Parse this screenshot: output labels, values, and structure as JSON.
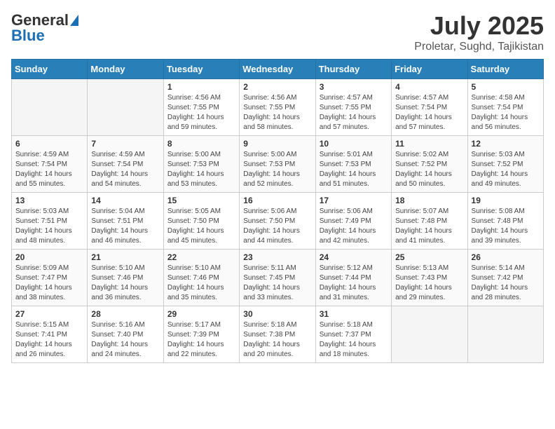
{
  "header": {
    "logo_general": "General",
    "logo_blue": "Blue",
    "month_title": "July 2025",
    "location": "Proletar, Sughd, Tajikistan"
  },
  "weekdays": [
    "Sunday",
    "Monday",
    "Tuesday",
    "Wednesday",
    "Thursday",
    "Friday",
    "Saturday"
  ],
  "weeks": [
    [
      {
        "day": "",
        "sunrise": "",
        "sunset": "",
        "daylight": "",
        "empty": true
      },
      {
        "day": "",
        "sunrise": "",
        "sunset": "",
        "daylight": "",
        "empty": true
      },
      {
        "day": "1",
        "sunrise": "Sunrise: 4:56 AM",
        "sunset": "Sunset: 7:55 PM",
        "daylight": "Daylight: 14 hours and 59 minutes."
      },
      {
        "day": "2",
        "sunrise": "Sunrise: 4:56 AM",
        "sunset": "Sunset: 7:55 PM",
        "daylight": "Daylight: 14 hours and 58 minutes."
      },
      {
        "day": "3",
        "sunrise": "Sunrise: 4:57 AM",
        "sunset": "Sunset: 7:55 PM",
        "daylight": "Daylight: 14 hours and 57 minutes."
      },
      {
        "day": "4",
        "sunrise": "Sunrise: 4:57 AM",
        "sunset": "Sunset: 7:54 PM",
        "daylight": "Daylight: 14 hours and 57 minutes."
      },
      {
        "day": "5",
        "sunrise": "Sunrise: 4:58 AM",
        "sunset": "Sunset: 7:54 PM",
        "daylight": "Daylight: 14 hours and 56 minutes."
      }
    ],
    [
      {
        "day": "6",
        "sunrise": "Sunrise: 4:59 AM",
        "sunset": "Sunset: 7:54 PM",
        "daylight": "Daylight: 14 hours and 55 minutes."
      },
      {
        "day": "7",
        "sunrise": "Sunrise: 4:59 AM",
        "sunset": "Sunset: 7:54 PM",
        "daylight": "Daylight: 14 hours and 54 minutes."
      },
      {
        "day": "8",
        "sunrise": "Sunrise: 5:00 AM",
        "sunset": "Sunset: 7:53 PM",
        "daylight": "Daylight: 14 hours and 53 minutes."
      },
      {
        "day": "9",
        "sunrise": "Sunrise: 5:00 AM",
        "sunset": "Sunset: 7:53 PM",
        "daylight": "Daylight: 14 hours and 52 minutes."
      },
      {
        "day": "10",
        "sunrise": "Sunrise: 5:01 AM",
        "sunset": "Sunset: 7:53 PM",
        "daylight": "Daylight: 14 hours and 51 minutes."
      },
      {
        "day": "11",
        "sunrise": "Sunrise: 5:02 AM",
        "sunset": "Sunset: 7:52 PM",
        "daylight": "Daylight: 14 hours and 50 minutes."
      },
      {
        "day": "12",
        "sunrise": "Sunrise: 5:03 AM",
        "sunset": "Sunset: 7:52 PM",
        "daylight": "Daylight: 14 hours and 49 minutes."
      }
    ],
    [
      {
        "day": "13",
        "sunrise": "Sunrise: 5:03 AM",
        "sunset": "Sunset: 7:51 PM",
        "daylight": "Daylight: 14 hours and 48 minutes."
      },
      {
        "day": "14",
        "sunrise": "Sunrise: 5:04 AM",
        "sunset": "Sunset: 7:51 PM",
        "daylight": "Daylight: 14 hours and 46 minutes."
      },
      {
        "day": "15",
        "sunrise": "Sunrise: 5:05 AM",
        "sunset": "Sunset: 7:50 PM",
        "daylight": "Daylight: 14 hours and 45 minutes."
      },
      {
        "day": "16",
        "sunrise": "Sunrise: 5:06 AM",
        "sunset": "Sunset: 7:50 PM",
        "daylight": "Daylight: 14 hours and 44 minutes."
      },
      {
        "day": "17",
        "sunrise": "Sunrise: 5:06 AM",
        "sunset": "Sunset: 7:49 PM",
        "daylight": "Daylight: 14 hours and 42 minutes."
      },
      {
        "day": "18",
        "sunrise": "Sunrise: 5:07 AM",
        "sunset": "Sunset: 7:48 PM",
        "daylight": "Daylight: 14 hours and 41 minutes."
      },
      {
        "day": "19",
        "sunrise": "Sunrise: 5:08 AM",
        "sunset": "Sunset: 7:48 PM",
        "daylight": "Daylight: 14 hours and 39 minutes."
      }
    ],
    [
      {
        "day": "20",
        "sunrise": "Sunrise: 5:09 AM",
        "sunset": "Sunset: 7:47 PM",
        "daylight": "Daylight: 14 hours and 38 minutes."
      },
      {
        "day": "21",
        "sunrise": "Sunrise: 5:10 AM",
        "sunset": "Sunset: 7:46 PM",
        "daylight": "Daylight: 14 hours and 36 minutes."
      },
      {
        "day": "22",
        "sunrise": "Sunrise: 5:10 AM",
        "sunset": "Sunset: 7:46 PM",
        "daylight": "Daylight: 14 hours and 35 minutes."
      },
      {
        "day": "23",
        "sunrise": "Sunrise: 5:11 AM",
        "sunset": "Sunset: 7:45 PM",
        "daylight": "Daylight: 14 hours and 33 minutes."
      },
      {
        "day": "24",
        "sunrise": "Sunrise: 5:12 AM",
        "sunset": "Sunset: 7:44 PM",
        "daylight": "Daylight: 14 hours and 31 minutes."
      },
      {
        "day": "25",
        "sunrise": "Sunrise: 5:13 AM",
        "sunset": "Sunset: 7:43 PM",
        "daylight": "Daylight: 14 hours and 29 minutes."
      },
      {
        "day": "26",
        "sunrise": "Sunrise: 5:14 AM",
        "sunset": "Sunset: 7:42 PM",
        "daylight": "Daylight: 14 hours and 28 minutes."
      }
    ],
    [
      {
        "day": "27",
        "sunrise": "Sunrise: 5:15 AM",
        "sunset": "Sunset: 7:41 PM",
        "daylight": "Daylight: 14 hours and 26 minutes."
      },
      {
        "day": "28",
        "sunrise": "Sunrise: 5:16 AM",
        "sunset": "Sunset: 7:40 PM",
        "daylight": "Daylight: 14 hours and 24 minutes."
      },
      {
        "day": "29",
        "sunrise": "Sunrise: 5:17 AM",
        "sunset": "Sunset: 7:39 PM",
        "daylight": "Daylight: 14 hours and 22 minutes."
      },
      {
        "day": "30",
        "sunrise": "Sunrise: 5:18 AM",
        "sunset": "Sunset: 7:38 PM",
        "daylight": "Daylight: 14 hours and 20 minutes."
      },
      {
        "day": "31",
        "sunrise": "Sunrise: 5:18 AM",
        "sunset": "Sunset: 7:37 PM",
        "daylight": "Daylight: 14 hours and 18 minutes."
      },
      {
        "day": "",
        "sunrise": "",
        "sunset": "",
        "daylight": "",
        "empty": true
      },
      {
        "day": "",
        "sunrise": "",
        "sunset": "",
        "daylight": "",
        "empty": true
      }
    ]
  ]
}
